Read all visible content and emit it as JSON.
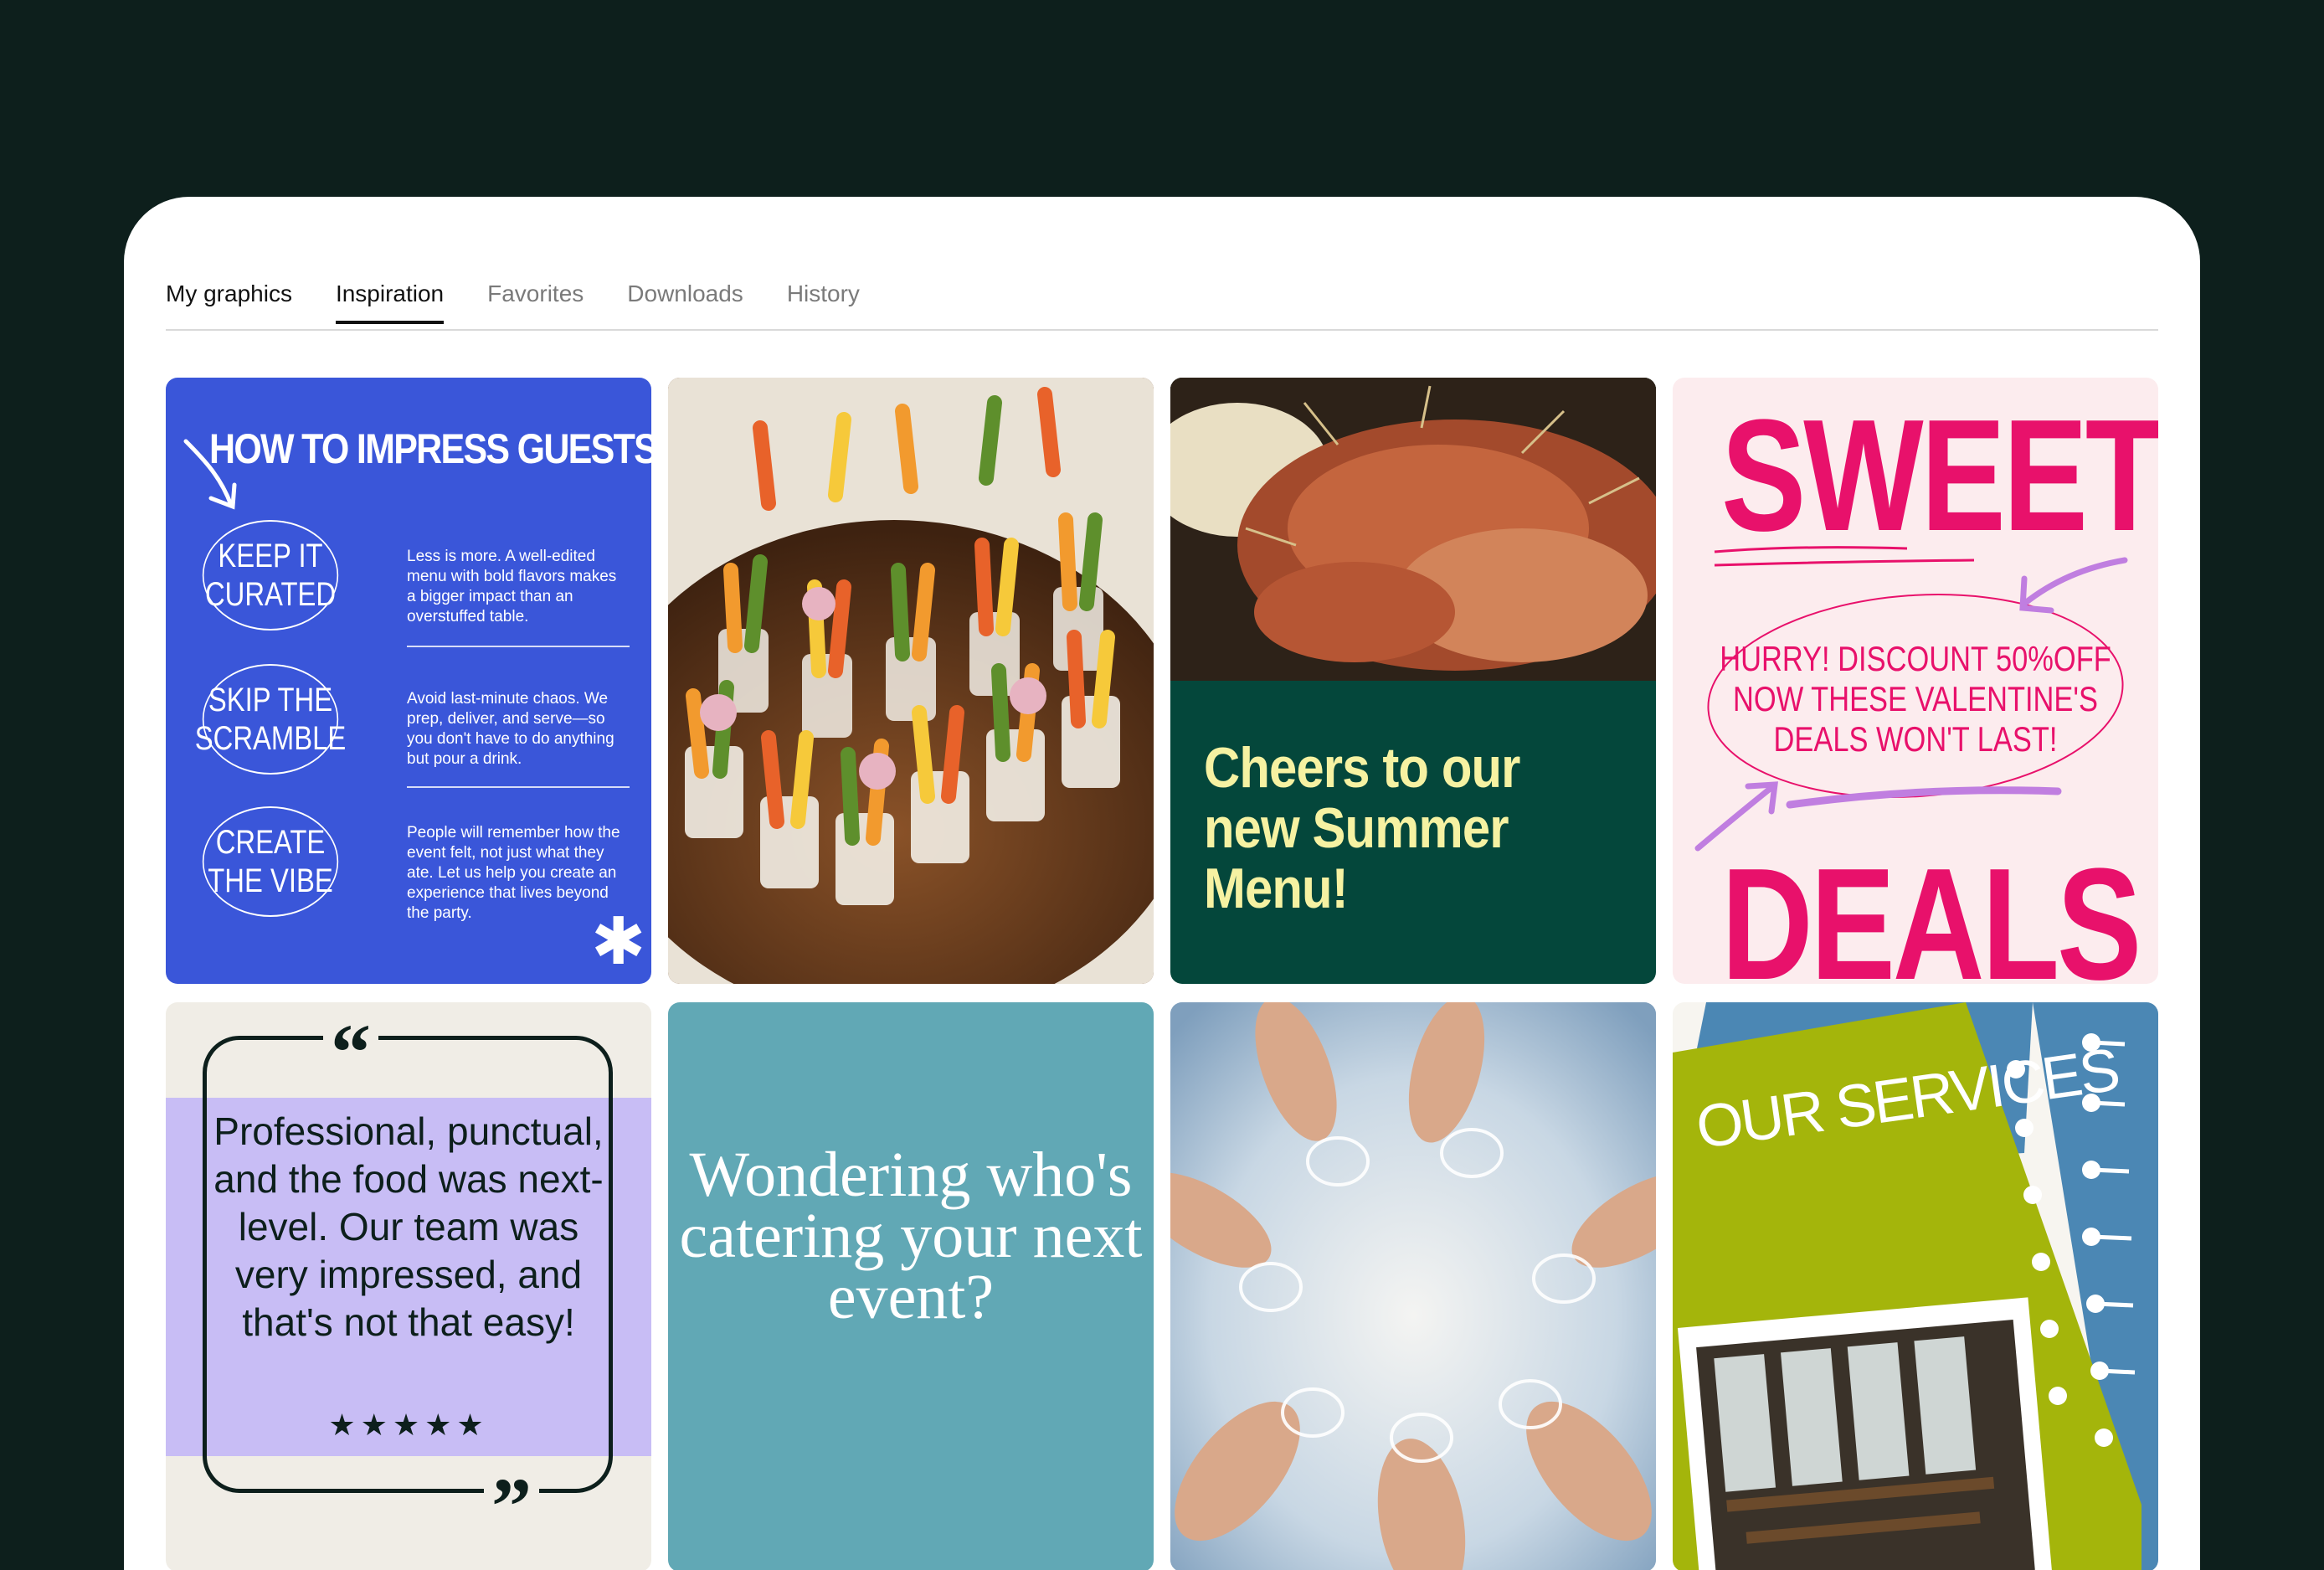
{
  "tabs": [
    {
      "label": "My graphics",
      "active": false
    },
    {
      "label": "Inspiration",
      "active": true
    },
    {
      "label": "Favorites",
      "active": false
    },
    {
      "label": "Downloads",
      "active": false
    },
    {
      "label": "History",
      "active": false
    }
  ],
  "tiles": {
    "guests": {
      "title": "HOW TO IMPRESS GUESTS",
      "items": [
        {
          "heading": "KEEP IT CURATED",
          "text": "Less is more. A well-edited menu with bold flavors makes a bigger impact than an overstuffed table."
        },
        {
          "heading": "SKIP THE SCRAMBLE",
          "text": "Avoid last-minute chaos. We prep, deliver, and serve—so you don't have to do anything but pour a drink."
        },
        {
          "heading": "CREATE THE VIBE",
          "text": "People will remember how the event felt, not just what they ate. Let us help you create an experience that lives beyond the party."
        }
      ],
      "background": "#3a56d9"
    },
    "summer": {
      "text": "Cheers to our new Summer Menu!",
      "background": "#04473b",
      "text_color": "#f6f2a2"
    },
    "deals": {
      "top": "SWEET",
      "middle": "HURRY! DISCOUNT 50%OFF NOW THESE VALENTINE'S DEALS WON'T LAST!",
      "bottom": "DEALS",
      "accent": "#e8116b"
    },
    "testimonial": {
      "quote": "Professional, punctual, and the food was next-level. Our team was very impressed, and that's not that easy!",
      "stars": "★★★★★",
      "rating": 5
    },
    "catering": {
      "text": "Wondering who's catering your next event?",
      "background": "#61a8b5"
    },
    "services": {
      "text": "OUR SERVICES",
      "accent": "#a4b50b"
    }
  }
}
